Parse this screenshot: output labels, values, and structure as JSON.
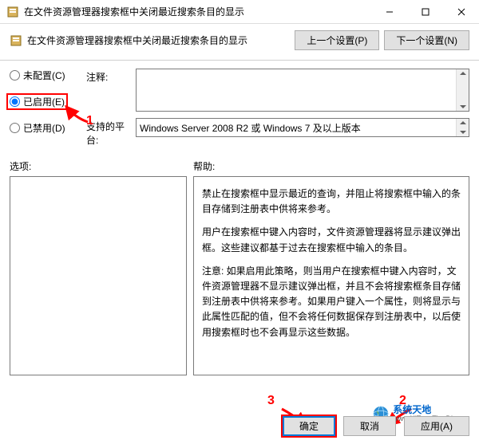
{
  "window": {
    "title": "在文件资源管理器搜索框中关闭最近搜索条目的显示"
  },
  "header": {
    "title": "在文件资源管理器搜索框中关闭最近搜索条目的显示",
    "prev": "上一个设置(P)",
    "next": "下一个设置(N)"
  },
  "radios": {
    "notconfig": "未配置(C)",
    "enabled": "已启用(E)",
    "disabled": "已禁用(D)"
  },
  "fields": {
    "comment_label": "注释:",
    "platform_label": "支持的平台:",
    "platform_value": "Windows Server 2008 R2 或 Windows 7 及以上版本"
  },
  "columns": {
    "options": "选项:",
    "help": "帮助:"
  },
  "help": {
    "p1": "禁止在搜索框中显示最近的查询，并阻止将搜索框中输入的条目存储到注册表中供将来参考。",
    "p2": "用户在搜索框中键入内容时，文件资源管理器将显示建议弹出框。这些建议都基于过去在搜索框中输入的条目。",
    "p3": "注意: 如果启用此策略，则当用户在搜索框中键入内容时，文件资源管理器不显示建议弹出框，并且不会将搜索框条目存储到注册表中供将来参考。如果用户键入一个属性，则将显示与此属性匹配的值，但不会将任何数据保存到注册表中，以后使用搜索框时也不会再显示这些数据。"
  },
  "footer": {
    "ok": "确定",
    "cancel": "取消",
    "apply": "应用(A)"
  },
  "annotations": {
    "a1": "1",
    "a2": "2",
    "a3": "3"
  },
  "watermark": {
    "name": "系统天地",
    "url": "www.XiTongTianDi.net"
  }
}
